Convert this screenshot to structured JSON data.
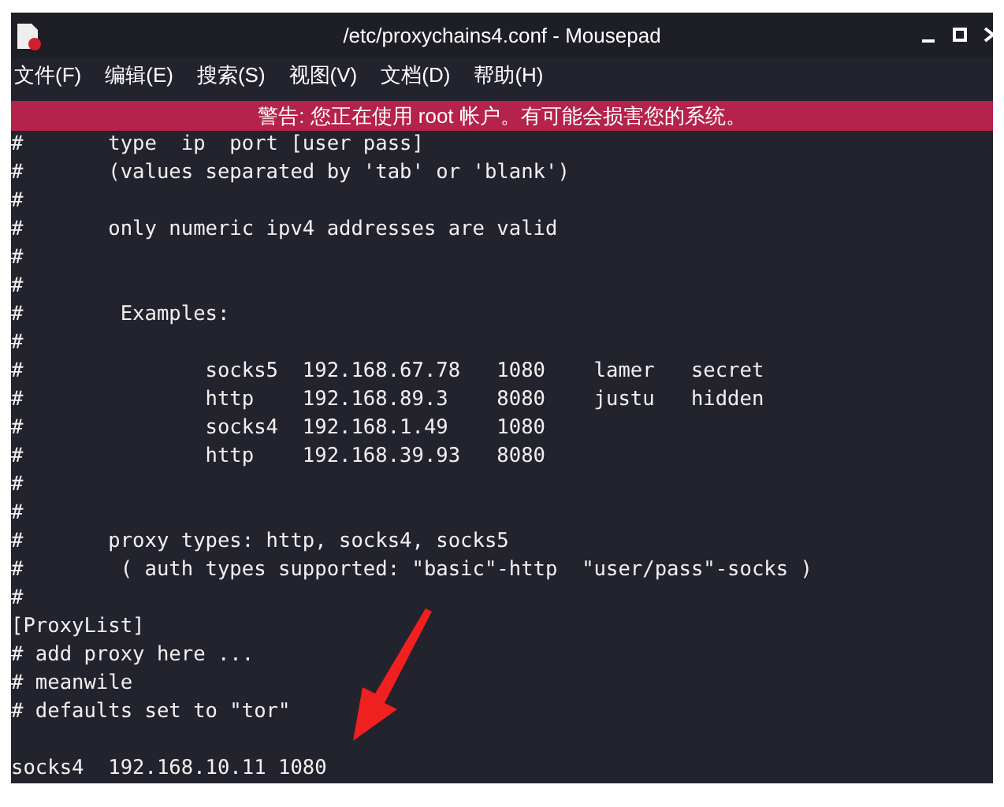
{
  "window": {
    "title": "/etc/proxychains4.conf - Mousepad"
  },
  "menu": [
    "文件(F)",
    "编辑(E)",
    "搜索(S)",
    "视图(V)",
    "文档(D)",
    "帮助(H)"
  ],
  "warning": "警告: 您正在使用 root 帐户。有可能会损害您的系统。",
  "lines": [
    {
      "kind": "text",
      "text": "#       type  ip  port [user pass]"
    },
    {
      "kind": "text",
      "text": "#       (values separated by 'tab' or 'blank')"
    },
    {
      "kind": "text",
      "text": "#"
    },
    {
      "kind": "text",
      "text": "#       only numeric ipv4 addresses are valid"
    },
    {
      "kind": "text",
      "text": "#"
    },
    {
      "kind": "text",
      "text": "#"
    },
    {
      "kind": "text",
      "text": "#        Examples:"
    },
    {
      "kind": "text",
      "text": "#"
    },
    {
      "kind": "text",
      "text": "#               socks5  192.168.67.78   1080    lamer   secret"
    },
    {
      "kind": "text",
      "text": "#               http    192.168.89.3    8080    justu   hidden"
    },
    {
      "kind": "text",
      "text": "#               socks4  192.168.1.49    1080"
    },
    {
      "kind": "text",
      "text": "#               http    192.168.39.93   8080"
    },
    {
      "kind": "text",
      "text": "#"
    },
    {
      "kind": "text",
      "text": "#"
    },
    {
      "kind": "text",
      "text": "#       proxy types: http, socks4, socks5"
    },
    {
      "kind": "text",
      "text": "#        ( auth types supported: \"basic\"-http  \"user/pass\"-socks )"
    },
    {
      "kind": "text",
      "text": "#"
    },
    {
      "kind": "text",
      "text": "[ProxyList]"
    },
    {
      "kind": "text",
      "text": "# add proxy here ..."
    },
    {
      "kind": "text",
      "text": "# meanwile"
    },
    {
      "kind": "text",
      "text": "# defaults set to \"tor\""
    },
    {
      "kind": "blank"
    },
    {
      "kind": "text",
      "text": "socks4  192.168.10.11 1080"
    }
  ]
}
